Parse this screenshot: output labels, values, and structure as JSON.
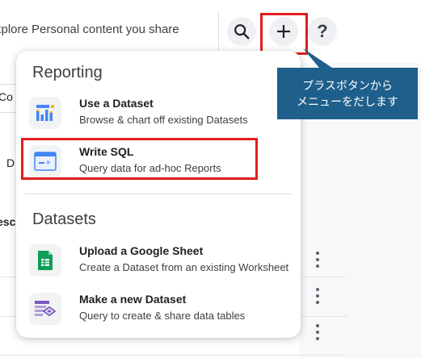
{
  "header": {
    "explore_text": "xplore Personal content you share",
    "search_icon": "search-icon",
    "plus_icon": "plus-icon",
    "help_label": "?"
  },
  "background": {
    "fragment_co": "Co",
    "fragment_d": "D",
    "fragment_esc": "esc"
  },
  "menu": {
    "reporting_title": "Reporting",
    "datasets_title": "Datasets",
    "items": [
      {
        "title": "Use a Dataset",
        "desc": "Browse & chart off existing Datasets",
        "icon": "dataset-chart-icon"
      },
      {
        "title": "Write SQL",
        "desc": "Query data for ad-hoc Reports",
        "icon": "sql-window-icon"
      },
      {
        "title": "Upload a Google Sheet",
        "desc": "Create a Dataset from an existing Worksheet",
        "icon": "google-sheet-icon"
      },
      {
        "title": "Make a new Dataset",
        "desc": "Query to create & share data tables",
        "icon": "new-dataset-icon"
      }
    ]
  },
  "callout": {
    "text": "プラスボタンから\nメニューをだします"
  },
  "colors": {
    "highlight": "#e21e1e",
    "callout_bg": "#1f5f8b"
  }
}
